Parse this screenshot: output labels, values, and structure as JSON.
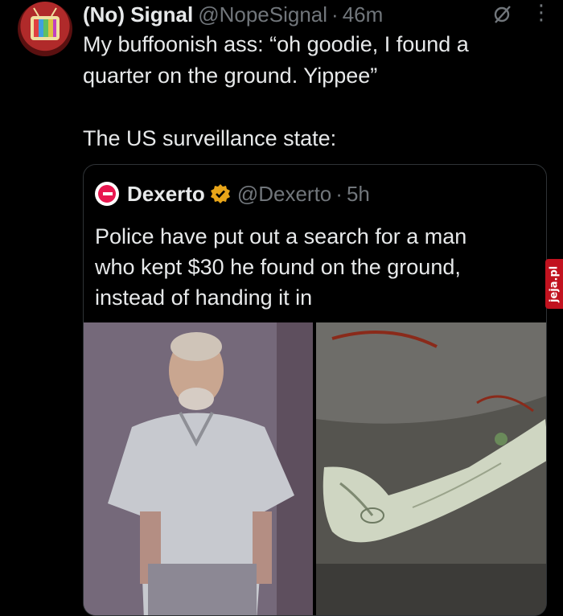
{
  "tweet": {
    "author_name": "(No) Signal",
    "author_handle": "@NopeSignal",
    "separator": "·",
    "time": "46m",
    "lines": [
      "My buffoonish ass: “oh goodie, I found a",
      "quarter on the ground. Yippee”",
      "The US surveillance state:"
    ]
  },
  "quote": {
    "author_name": "Dexerto",
    "author_handle": "@Dexerto",
    "separator": "·",
    "time": "5h",
    "lines": [
      "Police have put out a search for a man",
      "who kept $30 he found on the ground,",
      "instead of handing it in"
    ]
  },
  "watermark": "jeja.pl",
  "icons": {
    "grok": "grok-icon",
    "more": "more-vertical-icon",
    "verified": "verified-badge-icon"
  },
  "colors": {
    "background": "#000000",
    "text": "#e7e9ea",
    "muted": "#71767b",
    "verified_gold": "#e8a519",
    "watermark_red": "#c1121f"
  }
}
